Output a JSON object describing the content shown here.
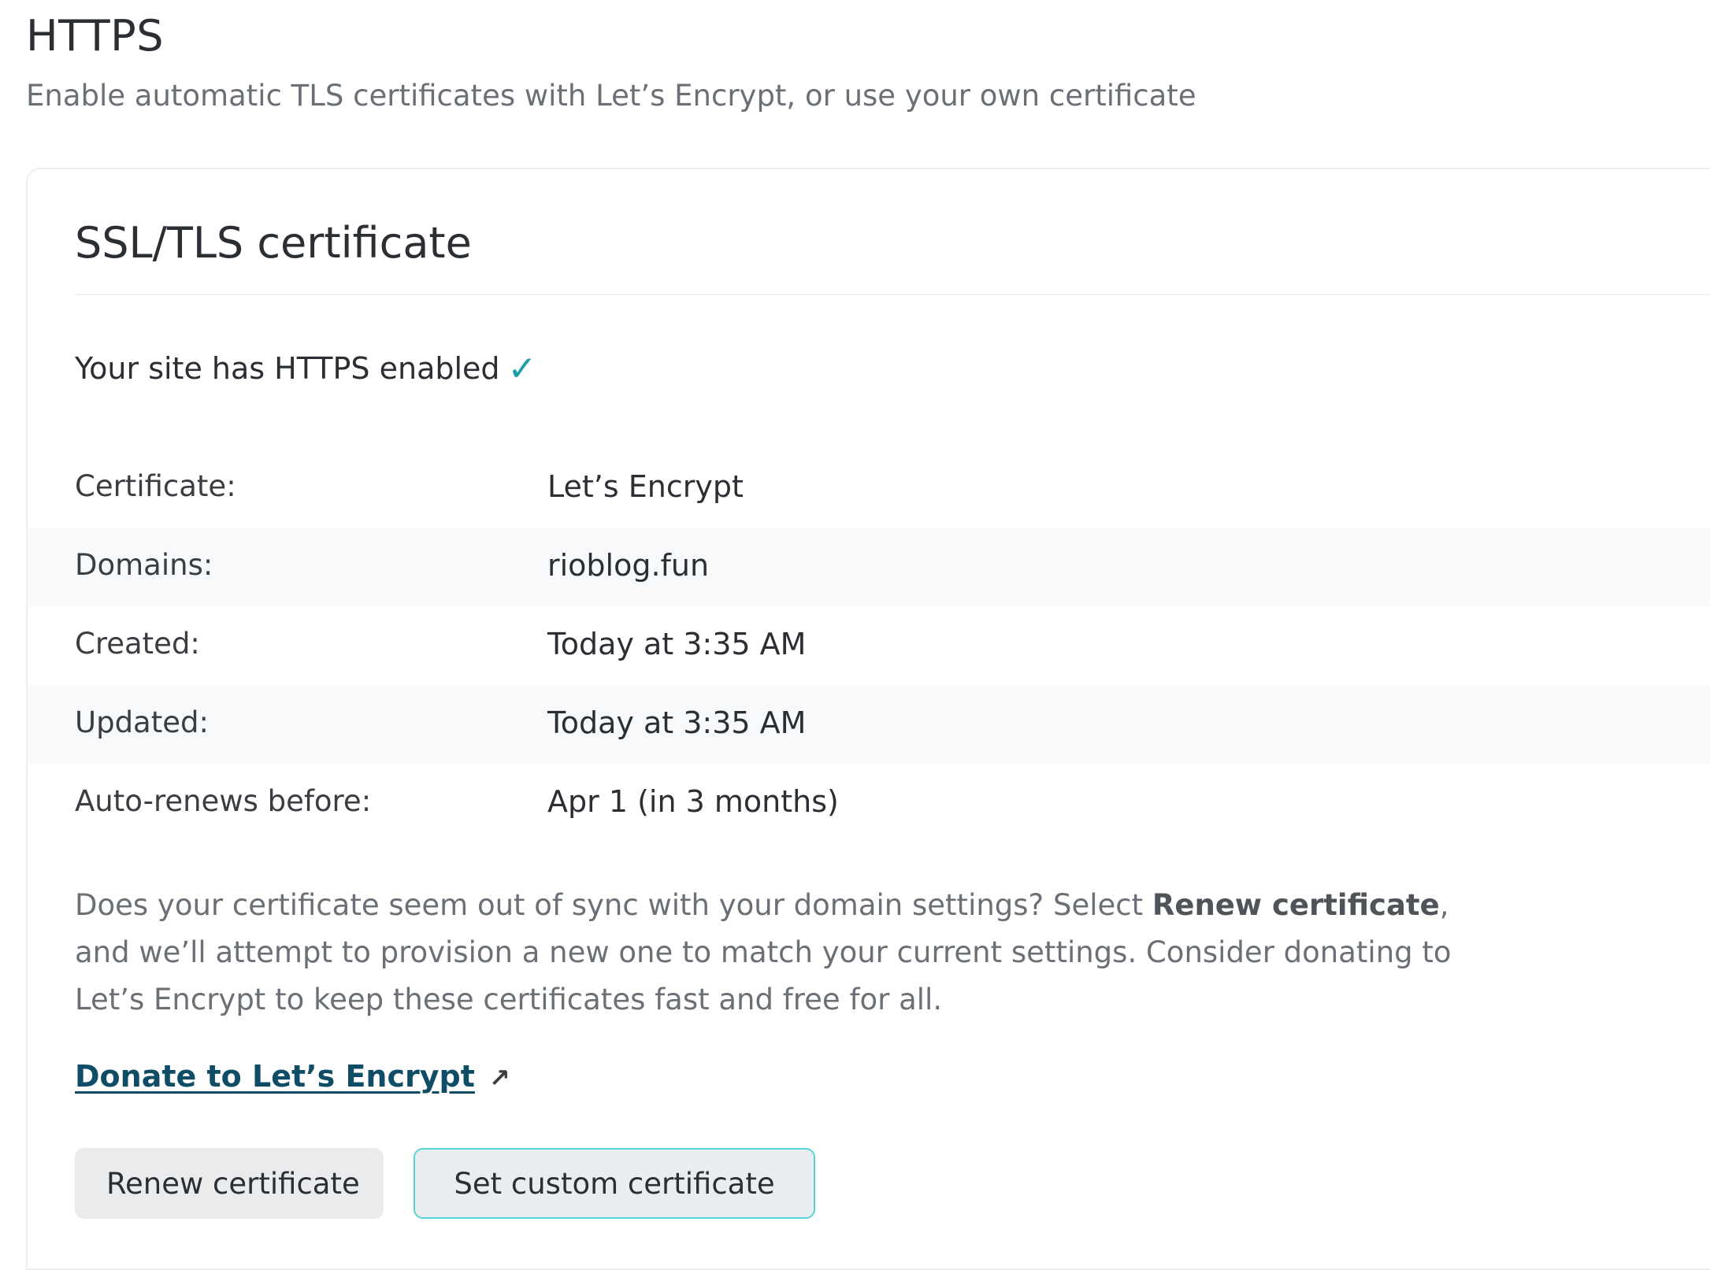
{
  "section": {
    "title": "HTTPS",
    "subtitle": "Enable automatic TLS certificates with Let’s Encrypt, or use your own certificate"
  },
  "card": {
    "title": "SSL/TLS certificate",
    "status_text": "Your site has HTTPS enabled",
    "status_icon": "check-icon",
    "status_icon_glyph": "✓",
    "accent_color": "#1a9ea8",
    "details": [
      {
        "label": "Certificate:",
        "value": "Let’s Encrypt"
      },
      {
        "label": "Domains:",
        "value": "rioblog.fun"
      },
      {
        "label": "Created:",
        "value": "Today at 3:35 AM"
      },
      {
        "label": "Updated:",
        "value": "Today at 3:35 AM"
      },
      {
        "label": "Auto-renews before:",
        "value": "Apr 1 (in 3 months)"
      }
    ],
    "help": {
      "part1": "Does your certificate seem out of sync with your domain settings? Select ",
      "bold": "Renew certificate",
      "part2": ", and we’ll attempt to provision a new one to match your current settings. Consider donating to Let’s Encrypt to keep these certificates fast and free for all."
    },
    "donate_link": {
      "label": "Donate to Let’s Encrypt",
      "icon": "external-link-icon",
      "icon_glyph": "↗"
    },
    "buttons": {
      "renew_label": "Renew certificate",
      "custom_label": "Set custom certificate"
    }
  }
}
